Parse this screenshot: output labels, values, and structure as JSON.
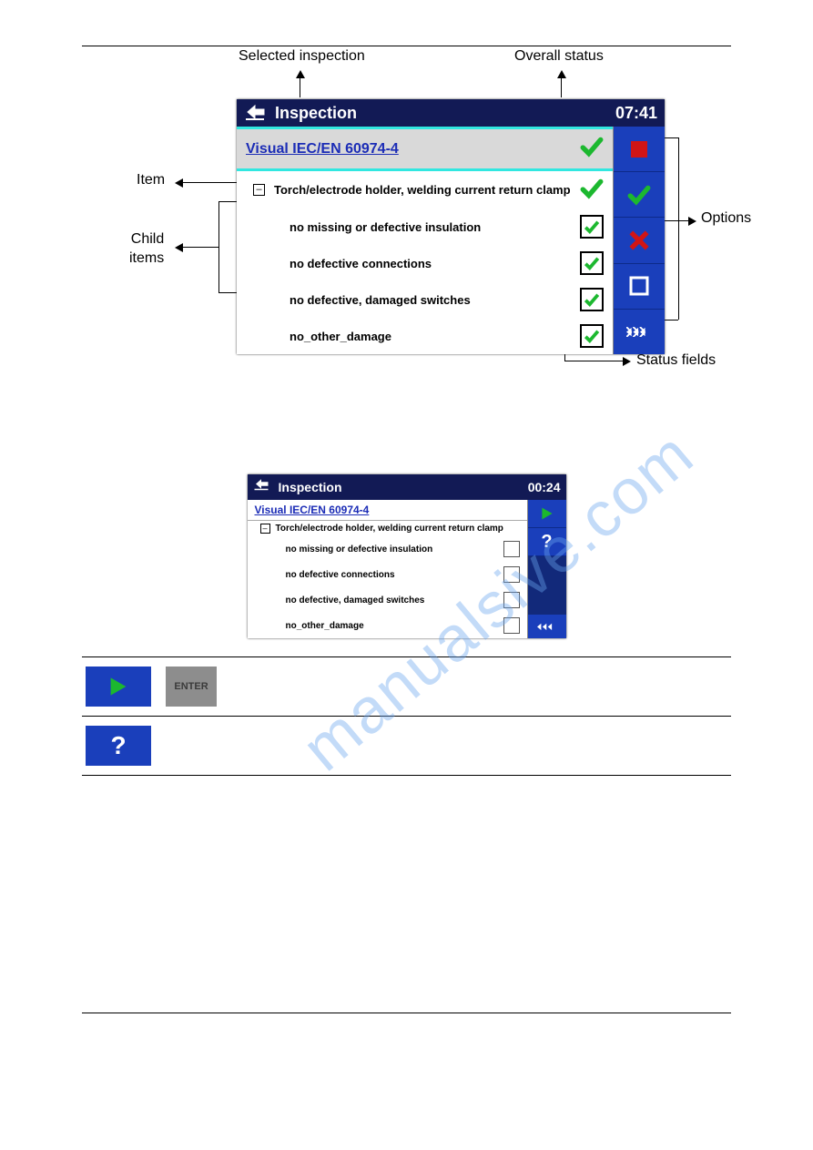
{
  "annotations": {
    "selected_inspection": "Selected inspection",
    "overall_status": "Overall status",
    "item": "Item",
    "child_items_line1": "Child",
    "child_items_line2": "items",
    "options": "Options",
    "status_fields": "Status fields"
  },
  "device1": {
    "title": "Inspection",
    "time": "07:41",
    "selected": "Visual IEC/EN 60974-4",
    "item": "Torch/electrode holder, welding current return clamp",
    "children": [
      "no missing or defective insulation",
      "no defective connections",
      "no defective, damaged switches",
      "no_other_damage"
    ]
  },
  "device2": {
    "title": "Inspection",
    "time": "00:24",
    "selected": "Visual IEC/EN 60974-4",
    "item": "Torch/electrode holder, welding current return clamp",
    "children": [
      "no missing or defective insulation",
      "no defective connections",
      "no defective, damaged switches",
      "no_other_damage"
    ]
  },
  "buttons": {
    "enter": "ENTER"
  },
  "watermark": "manualsive.com"
}
